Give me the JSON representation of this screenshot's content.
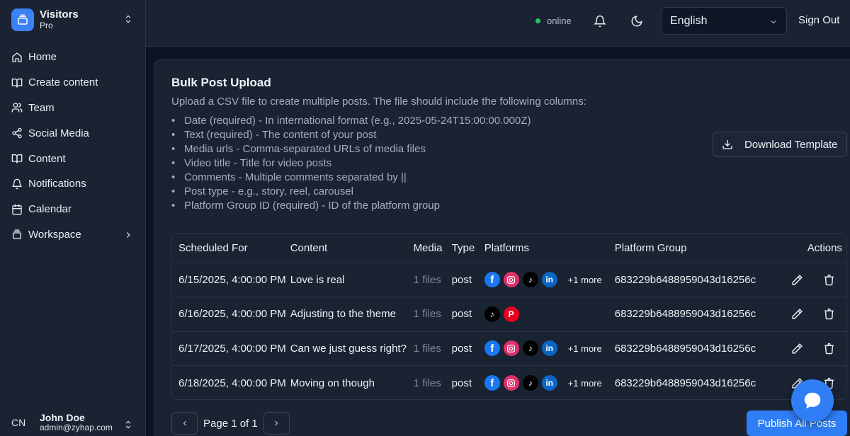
{
  "brand": {
    "name": "Visitors",
    "plan": "Pro"
  },
  "nav": [
    {
      "label": "Home",
      "icon": "home-icon"
    },
    {
      "label": "Create content",
      "icon": "book-open-icon"
    },
    {
      "label": "Team",
      "icon": "users-icon"
    },
    {
      "label": "Social Media",
      "icon": "share-icon"
    },
    {
      "label": "Content",
      "icon": "book-open-icon"
    },
    {
      "label": "Notifications",
      "icon": "bell-icon"
    },
    {
      "label": "Calendar",
      "icon": "calendar-icon"
    },
    {
      "label": "Workspace",
      "icon": "layers-icon"
    }
  ],
  "user": {
    "initials": "CN",
    "name": "John Doe",
    "email": "admin@zyhap.com"
  },
  "header": {
    "status": "online",
    "language": "English",
    "sign_out": "Sign Out"
  },
  "card": {
    "title": "Bulk Post Upload",
    "description": "Upload a CSV file to create multiple posts. The file should include the following columns:",
    "columns": [
      "Date (required) - In international format (e.g., 2025-05-24T15:00:00.000Z)",
      "Text (required) - The content of your post",
      "Media urls - Comma-separated URLs of media files",
      "Video title - Title for video posts",
      "Comments - Multiple comments separated by ||",
      "Post type - e.g., story, reel, carousel",
      "Platform Group ID (required) - ID of the platform group"
    ],
    "download_label": "Download Template"
  },
  "table": {
    "headers": [
      "Scheduled For",
      "Content",
      "Media",
      "Type",
      "Platforms",
      "Platform Group",
      "Actions"
    ],
    "rows": [
      {
        "scheduled": "6/15/2025, 4:00:00 PM",
        "content": "Love is real",
        "media": "1 files",
        "type": "post",
        "platforms": [
          "facebook",
          "instagram",
          "tiktok",
          "linkedin"
        ],
        "more": "+1 more",
        "group": "683229b6488959043d16256c"
      },
      {
        "scheduled": "6/16/2025, 4:00:00 PM",
        "content": "Adjusting to the theme",
        "media": "1 files",
        "type": "post",
        "platforms": [
          "tiktok",
          "pinterest"
        ],
        "more": "",
        "group": "683229b6488959043d16256c"
      },
      {
        "scheduled": "6/17/2025, 4:00:00 PM",
        "content": "Can we just guess right?",
        "media": "1 files",
        "type": "post",
        "platforms": [
          "facebook",
          "instagram",
          "tiktok",
          "linkedin"
        ],
        "more": "+1 more",
        "group": "683229b6488959043d16256c"
      },
      {
        "scheduled": "6/18/2025, 4:00:00 PM",
        "content": "Moving on though",
        "media": "1 files",
        "type": "post",
        "platforms": [
          "facebook",
          "instagram",
          "tiktok",
          "linkedin"
        ],
        "more": "+1 more",
        "group": "683229b6488959043d16256c"
      }
    ]
  },
  "pagination": {
    "label": "Page 1 of 1"
  },
  "publish_label": "Publish All Posts",
  "colors": {
    "accent": "#2f7ef6",
    "online": "#22c55e",
    "background": "#1a2332"
  }
}
